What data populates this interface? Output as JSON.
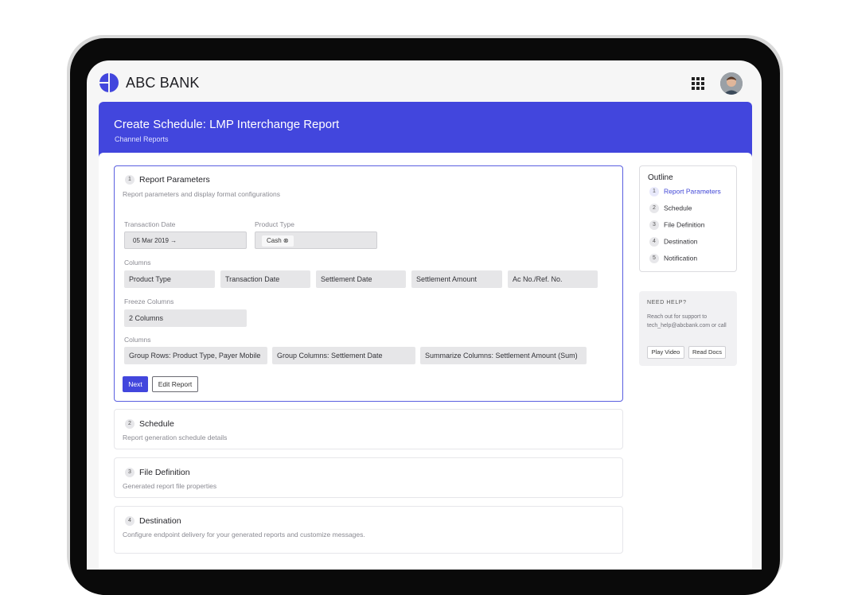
{
  "brand": {
    "name": "ABC BANK",
    "accent": "#4246dd"
  },
  "header": {
    "title": "Create Schedule:  LMP  Interchange Report",
    "subtitle": "Channel Reports"
  },
  "steps": [
    {
      "num": "1",
      "title": "Report Parameters",
      "desc": "Report parameters and display format configurations"
    },
    {
      "num": "2",
      "title": "Schedule",
      "desc": "Report generation schedule details"
    },
    {
      "num": "3",
      "title": "File Definition",
      "desc": "Generated report file properties"
    },
    {
      "num": "4",
      "title": "Destination",
      "desc": "Configure endpoint delivery for your generated reports and customize messages."
    }
  ],
  "form": {
    "transaction_date": {
      "label": "Transaction Date",
      "value": "05 Mar 2019 →"
    },
    "product_type": {
      "label": "Product Type",
      "value": "Cash"
    },
    "columns": {
      "label": "Columns",
      "items": [
        "Product Type",
        "Transaction Date",
        "Settlement Date",
        "Settlement Amount",
        "Ac No./Ref. No."
      ]
    },
    "freeze": {
      "label": "Freeze Columns",
      "value": "2 Columns"
    },
    "grouping": {
      "label": "Columns",
      "items": [
        "Group Rows: Product Type, Payer Mobile",
        "Group Columns: Settlement Date",
        "Summarize Columns: Settlement Amount (Sum)"
      ]
    },
    "next_label": "Next",
    "edit_label": "Edit Report"
  },
  "outline": {
    "title": "Outline",
    "items": [
      {
        "num": "1",
        "label": "Report Parameters"
      },
      {
        "num": "2",
        "label": "Schedule"
      },
      {
        "num": "3",
        "label": "File Definition"
      },
      {
        "num": "4",
        "label": "Destination"
      },
      {
        "num": "5",
        "label": "Notification"
      }
    ]
  },
  "help": {
    "title": "NEED HELP?",
    "text": "Reach out for support to tech_help@abcbank.com or call",
    "play_label": "Play Video",
    "docs_label": "Read Docs"
  }
}
